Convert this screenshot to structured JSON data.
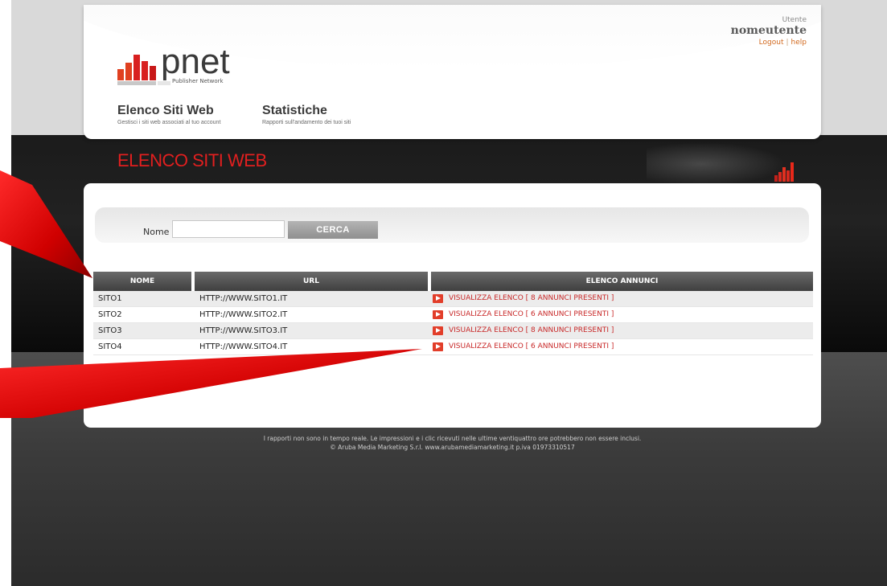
{
  "header": {
    "logo_text": "pnet",
    "logo_subtitle": "Publisher Network",
    "nav": [
      {
        "title": "Elenco Siti Web",
        "subtitle": "Gestisci i siti web associati al tuo account"
      },
      {
        "title": "Statistiche",
        "subtitle": "Rapporti sull'andamento dei tuoi siti"
      }
    ],
    "user_label": "Utente",
    "username": "nomeutente",
    "logout_label": "Logout",
    "separator": "|",
    "help_label": "help"
  },
  "page_title": "ELENCO SITI WEB",
  "search": {
    "label": "Nome",
    "value": "",
    "button_label": "CERCA"
  },
  "table": {
    "headers": [
      "NOME",
      "URL",
      "ELENCO ANNUNCI"
    ],
    "rows": [
      {
        "name": "SITO1",
        "url": "HTTP://WWW.SITO1.IT",
        "ads": "VISUALIZZA ELENCO [ 8 ANNUNCI PRESENTI ]"
      },
      {
        "name": "SITO2",
        "url": "HTTP://WWW.SITO2.IT",
        "ads": "VISUALIZZA ELENCO [ 6 ANNUNCI PRESENTI ]"
      },
      {
        "name": "SITO3",
        "url": "HTTP://WWW.SITO3.IT",
        "ads": "VISUALIZZA ELENCO [ 8 ANNUNCI PRESENTI ]"
      },
      {
        "name": "SITO4",
        "url": "HTTP://WWW.SITO4.IT",
        "ads": "VISUALIZZA ELENCO [ 6 ANNUNCI PRESENTI ]"
      }
    ]
  },
  "footer": {
    "line1": "I rapporti non sono in tempo reale. Le impressioni e i clic ricevuti nelle ultime ventiquattro ore potrebbero non essere inclusi.",
    "line2": "© Aruba Media Marketing S.r.l. www.arubamediamarketing.it p.iva 01973310517"
  },
  "colors": {
    "accent_red": "#e21f1f",
    "link_orange": "#d2691e",
    "header_dark": "#4a4a4a",
    "background_dark": "#1b1b1b"
  },
  "icons": [
    "logo-bars-icon",
    "play-icon",
    "corner-bars-icon",
    "callout-arrow-icon"
  ]
}
